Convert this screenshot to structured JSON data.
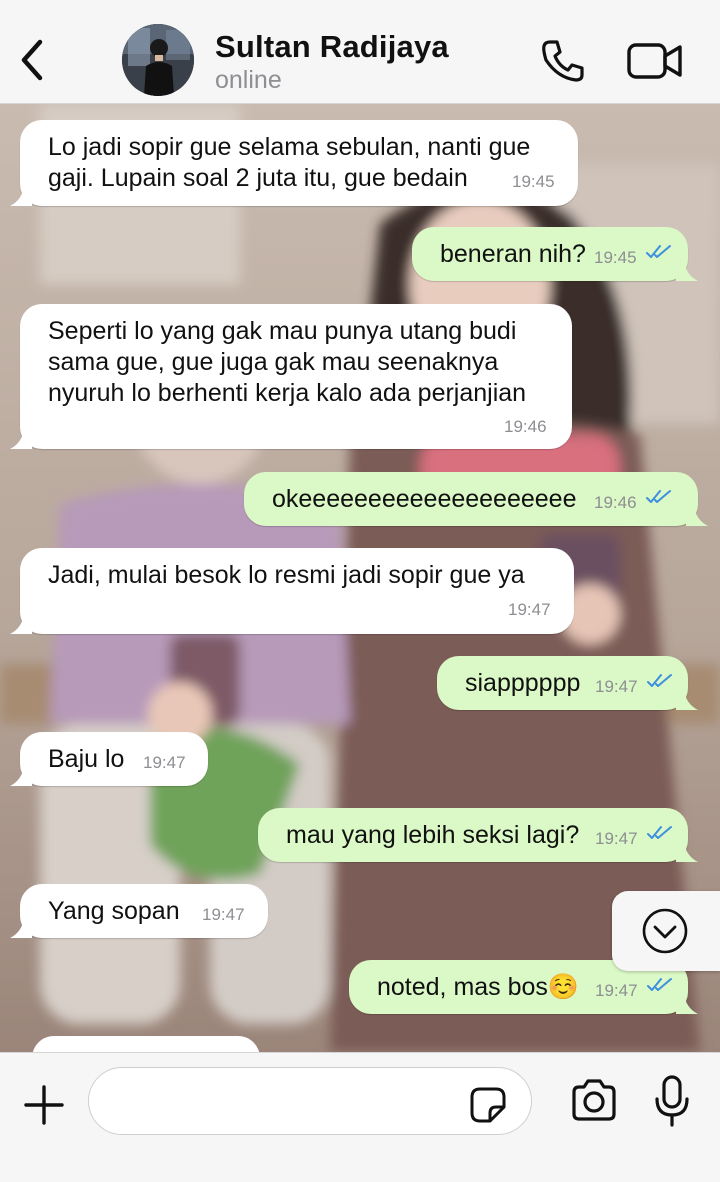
{
  "header": {
    "contact_name": "Sultan Radijaya",
    "status": "online"
  },
  "messages": [
    {
      "dir": "in",
      "text": "Lo jadi sopir gue selama sebulan, nanti gue\ngaji. Lupain soal 2 juta itu, gue bedain",
      "time": "19:45"
    },
    {
      "dir": "out",
      "text": "beneran nih?",
      "time": "19:45",
      "read": true
    },
    {
      "dir": "in",
      "text": "Seperti lo yang gak mau punya utang budi\nsama gue, gue juga gak mau seenaknya\nnyuruh lo berhenti kerja kalo ada perjanjian",
      "time": "19:46"
    },
    {
      "dir": "out",
      "text": "okeeeeeeeeeeeeeeeeeeee",
      "time": "19:46",
      "read": true
    },
    {
      "dir": "in",
      "text": "Jadi, mulai besok lo resmi jadi sopir gue ya",
      "time": "19:47"
    },
    {
      "dir": "out",
      "text": "siapppppp",
      "time": "19:47",
      "read": true
    },
    {
      "dir": "in",
      "text": "Baju lo",
      "time": "19:47"
    },
    {
      "dir": "out",
      "text": "mau yang lebih seksi lagi?",
      "time": "19:47",
      "read": true
    },
    {
      "dir": "in",
      "text": "Yang sopan",
      "time": "19:47"
    },
    {
      "dir": "out",
      "text": "noted, mas bos☺️",
      "time": "19:47",
      "read": true
    }
  ],
  "composer": {
    "placeholder": ""
  },
  "colors": {
    "incoming_bubble": "#ffffff",
    "outgoing_bubble": "#dbf9c6",
    "read_ticks": "#3d8fe0",
    "bar_background": "#f6f6f6"
  },
  "icons": {
    "back": "chevron-left-icon",
    "call": "phone-icon",
    "video": "video-camera-icon",
    "scroll": "chevron-down-circle-icon",
    "attach": "plus-icon",
    "sticker": "sticker-icon",
    "camera": "camera-icon",
    "mic": "microphone-icon"
  }
}
